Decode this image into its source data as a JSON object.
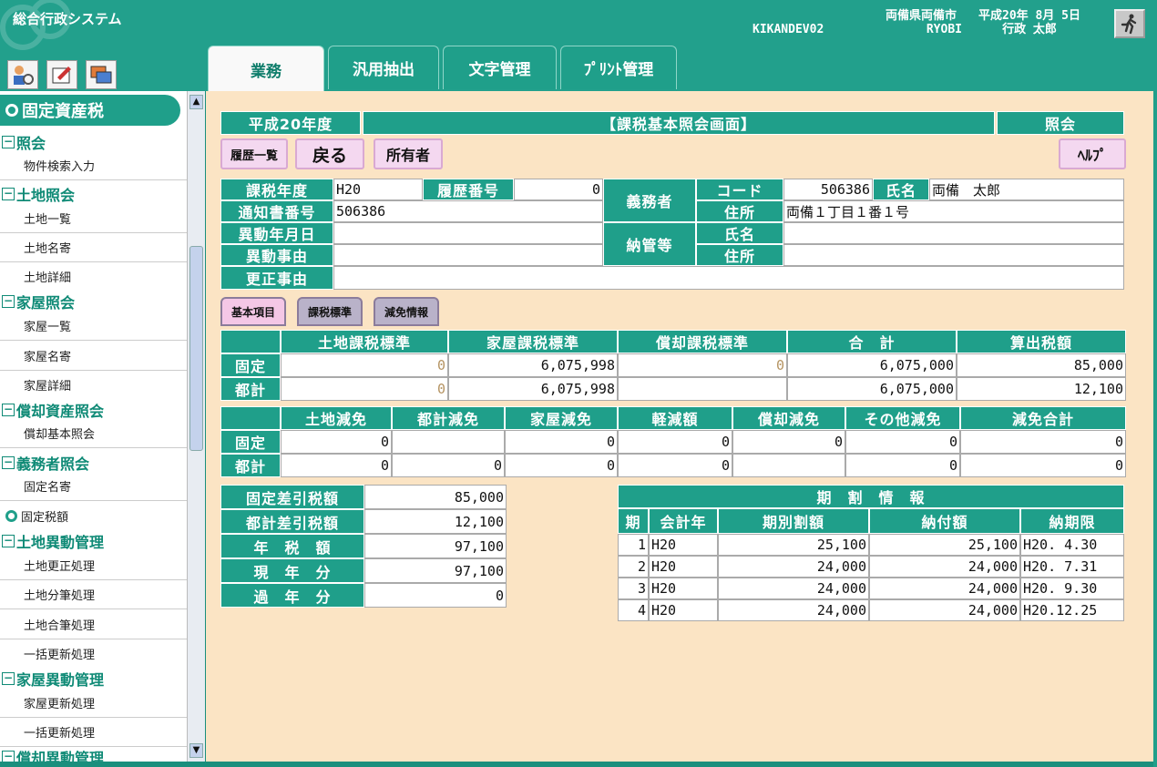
{
  "header": {
    "app_title": "総合行政システム",
    "municipality": "両備県両備市",
    "terminal": "KIKANDEV02",
    "date": "平成20年 8月 5日",
    "user_id": "RYOBI",
    "user_name": "行政 太郎"
  },
  "tabs": [
    "業務",
    "汎用抽出",
    "文字管理",
    "ﾌﾟﾘﾝﾄ管理"
  ],
  "sidebar": {
    "title": "固定資産税",
    "groups": [
      {
        "label": "照会",
        "items": [
          "物件検索入力"
        ]
      },
      {
        "label": "土地照会",
        "items": [
          "土地一覧",
          "土地名寄",
          "土地詳細"
        ]
      },
      {
        "label": "家屋照会",
        "items": [
          "家屋一覧",
          "家屋名寄",
          "家屋詳細"
        ]
      },
      {
        "label": "償却資産照会",
        "items": [
          "償却基本照会"
        ]
      },
      {
        "label": "義務者照会",
        "items": [
          "固定名寄"
        ]
      },
      {
        "label": "土地異動管理",
        "items": [
          "土地更正処理",
          "土地分筆処理",
          "土地合筆処理",
          "一括更新処理"
        ]
      },
      {
        "label": "家屋異動管理",
        "items": [
          "家屋更新処理",
          "一括更新処理"
        ]
      },
      {
        "label": "償却異動管理",
        "items": []
      }
    ],
    "selected_item": "固定税額"
  },
  "main": {
    "era_year": "平成20年度",
    "screen_title": "【課税基本照会画面】",
    "mode": "照会",
    "buttons": {
      "history": "履歴一覧",
      "back": "戻る",
      "owner": "所有者",
      "help": "ﾍﾙﾌﾟ"
    },
    "info": {
      "tax_year_label": "課税年度",
      "tax_year": "H20",
      "history_no_label": "履歴番号",
      "history_no": "0",
      "notice_no_label": "通知書番号",
      "notice_no": "506386",
      "change_date_label": "異動年月日",
      "change_date": "",
      "change_reason_label": "異動事由",
      "change_reason": "",
      "correction_reason_label": "更正事由",
      "correction_reason": "",
      "obligor_label": "義務者",
      "code_label": "コード",
      "code": "506386",
      "name_label": "氏名",
      "name": "両備　太郎",
      "address_label": "住所",
      "address": "両備１丁目１番１号",
      "manager_label": "納管等",
      "manager_name_label": "氏名",
      "manager_name": "",
      "manager_address_label": "住所",
      "manager_address": ""
    },
    "subtabs": [
      "基本項目",
      "課税標準",
      "減免情報"
    ],
    "standard_table": {
      "headers": [
        "土地課税標準",
        "家屋課税標準",
        "償却課税標準",
        "合　計",
        "算出税額"
      ],
      "rows": [
        {
          "label": "固定",
          "values": [
            "0",
            "6,075,998",
            "0",
            "6,075,000",
            "85,000"
          ]
        },
        {
          "label": "都計",
          "values": [
            "0",
            "6,075,998",
            "",
            "6,075,000",
            "12,100"
          ]
        }
      ]
    },
    "reduction_table": {
      "headers": [
        "土地減免",
        "都計減免",
        "家屋減免",
        "軽減額",
        "償却減免",
        "その他減免",
        "減免合計"
      ],
      "rows": [
        {
          "label": "固定",
          "values": [
            "0",
            "",
            "0",
            "0",
            "0",
            "0",
            "0"
          ]
        },
        {
          "label": "都計",
          "values": [
            "0",
            "0",
            "0",
            "0",
            "",
            "0",
            "0"
          ]
        }
      ]
    },
    "summary": [
      {
        "label": "固定差引税額",
        "value": "85,000"
      },
      {
        "label": "都計差引税額",
        "value": "12,100"
      },
      {
        "label": "年　税　額",
        "value": "97,100"
      },
      {
        "label": "現　年　分",
        "value": "97,100"
      },
      {
        "label": "過　年　分",
        "value": "0"
      }
    ],
    "installments": {
      "title": "期　割　情　報",
      "headers": [
        "期",
        "会計年",
        "期別割額",
        "納付額",
        "納期限"
      ],
      "rows": [
        [
          "1",
          "H20",
          "25,100",
          "25,100",
          "H20. 4.30"
        ],
        [
          "2",
          "H20",
          "24,000",
          "24,000",
          "H20. 7.31"
        ],
        [
          "3",
          "H20",
          "24,000",
          "24,000",
          "H20. 9.30"
        ],
        [
          "4",
          "H20",
          "24,000",
          "24,000",
          "H20.12.25"
        ]
      ]
    }
  }
}
